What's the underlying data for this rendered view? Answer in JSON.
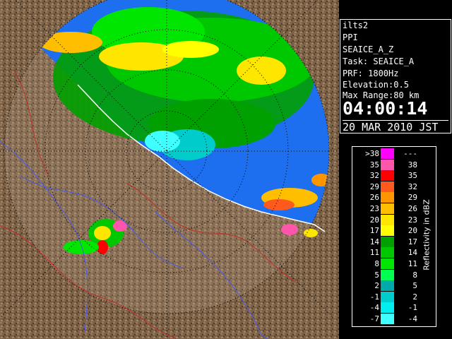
{
  "info": {
    "station": "ilts2",
    "scan_type": "PPI",
    "product": "SEAICE_A_Z",
    "task": "Task: SEAICE_A",
    "prf": "PRF: 1800Hz",
    "elevation": "Elevation:0.5",
    "max_range": "Max Range:80 km",
    "time": "04:00:14",
    "date": "20 MAR 2010 JST"
  },
  "scale": {
    "unit_label": "Reflectivity in dBZ",
    "rows": [
      {
        "lo": ">38",
        "hi": "---",
        "color": "#ff00ff"
      },
      {
        "lo": "35",
        "hi": "38",
        "color": "#ff55aa"
      },
      {
        "lo": "32",
        "hi": "35",
        "color": "#ff0000"
      },
      {
        "lo": "29",
        "hi": "32",
        "color": "#ff5a1e"
      },
      {
        "lo": "26",
        "hi": "29",
        "color": "#ff9600"
      },
      {
        "lo": "23",
        "hi": "26",
        "color": "#ffbe00"
      },
      {
        "lo": "20",
        "hi": "23",
        "color": "#ffe600"
      },
      {
        "lo": "17",
        "hi": "20",
        "color": "#ffff00"
      },
      {
        "lo": "14",
        "hi": "17",
        "color": "#00a000"
      },
      {
        "lo": "11",
        "hi": "14",
        "color": "#00c800"
      },
      {
        "lo": "8",
        "hi": "11",
        "color": "#00e600"
      },
      {
        "lo": "5",
        "hi": "8",
        "color": "#00ff50"
      },
      {
        "lo": "2",
        "hi": "5",
        "color": "#00aaaa"
      },
      {
        "lo": "-1",
        "hi": "2",
        "color": "#00cccc"
      },
      {
        "lo": "-4",
        "hi": "-1",
        "color": "#00eeee"
      },
      {
        "lo": "-7",
        "hi": "-4",
        "color": "#40ffff"
      }
    ]
  },
  "colors": {
    "sea": "#1e6ff0",
    "land": "#7a6048",
    "background": "#000000",
    "rivers": "#4a5ae8",
    "borders": "#c0302a"
  }
}
